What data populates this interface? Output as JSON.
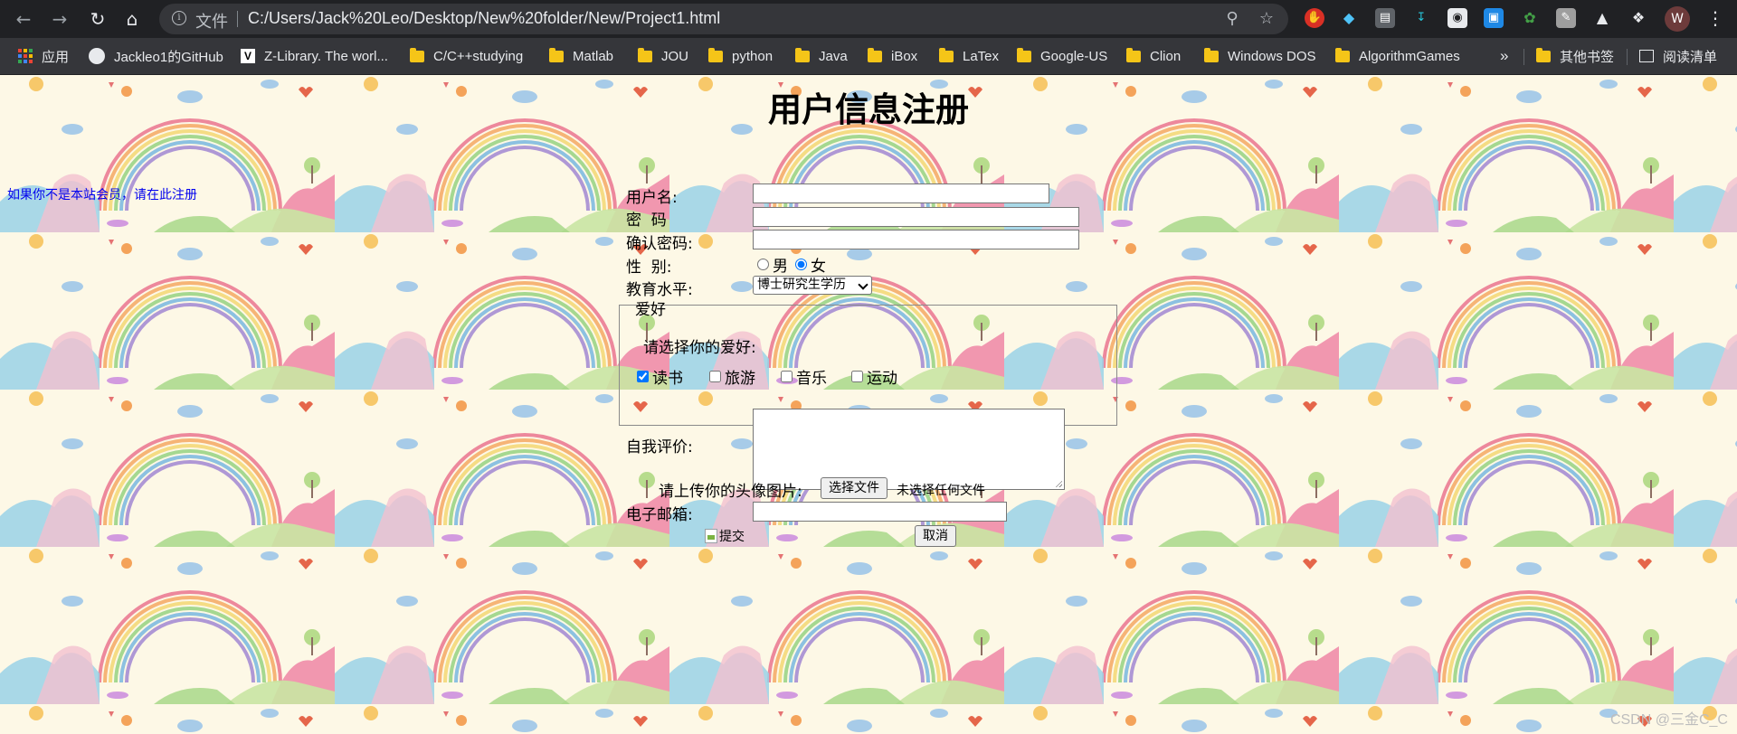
{
  "browser": {
    "omnibox": {
      "file_label": "文件",
      "url": "C:/Users/Jack%20Leo/Desktop/New%20folder/New/Project1.html"
    },
    "profile_initial": "W",
    "bookmarks": [
      {
        "label": "应用"
      },
      {
        "label": "Jackleo1的GitHub"
      },
      {
        "label": "Z-Library. The worl..."
      },
      {
        "label": "C/C++studying"
      },
      {
        "label": "Matlab"
      },
      {
        "label": "JOU"
      },
      {
        "label": "python"
      },
      {
        "label": "Java"
      },
      {
        "label": "iBox"
      },
      {
        "label": "LaTex"
      },
      {
        "label": "Google-US"
      },
      {
        "label": "Clion"
      },
      {
        "label": "Windows DOS"
      },
      {
        "label": "AlgorithmGames"
      }
    ],
    "overflow": "»",
    "other_bookmarks": "其他书签",
    "reading_list": "阅读清单"
  },
  "page": {
    "title": "用户信息注册",
    "register_link": "如果你不是本站会员，请在此注册",
    "form": {
      "username_label": "用户名:",
      "password_label": "密  码",
      "confirm_label": "确认密码:",
      "gender_label": "性  别:",
      "gender_options": [
        "男",
        "女"
      ],
      "gender_selected": "女",
      "education_label": "教育水平:",
      "education_selected": "博士研究生学历",
      "hobby_legend": "爱好",
      "hobby_prompt": "请选择你的爱好:",
      "hobbies": [
        {
          "label": "读书",
          "checked": true
        },
        {
          "label": "旅游",
          "checked": false
        },
        {
          "label": "音乐",
          "checked": false
        },
        {
          "label": "运动",
          "checked": false
        }
      ],
      "self_eval_label": "自我评价:",
      "avatar_label": "请上传你的头像图片:",
      "choose_file_button": "选择文件",
      "no_file_text": "未选择任何文件",
      "email_label": "电子邮箱:",
      "submit_alt": "提交",
      "cancel_button": "取消"
    },
    "watermark": "CSDN @三金C_C"
  }
}
